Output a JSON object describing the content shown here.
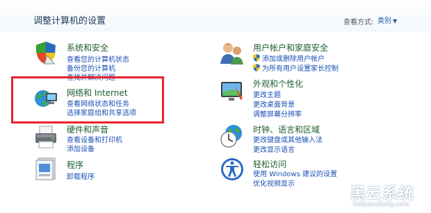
{
  "header": {
    "title": "调整计算机的设置",
    "view_label": "查看方式:",
    "view_value": "类别"
  },
  "categories": [
    {
      "title": "系统和安全",
      "icon": "security-shield-icon",
      "links": [
        "查看您的计算机状态",
        "备份您的计算机",
        "查找并解决问题"
      ]
    },
    {
      "title": "网络和 Internet",
      "icon": "network-globe-icon",
      "links": [
        "查看网络状态和任务",
        "选择家庭组和共享选项"
      ]
    },
    {
      "title": "硬件和声音",
      "icon": "printer-icon",
      "links": [
        "查看设备和打印机",
        "添加设备"
      ]
    },
    {
      "title": "程序",
      "icon": "programs-icon",
      "links": [
        "卸载程序"
      ]
    },
    {
      "title": "用户帐户和家庭安全",
      "icon": "users-icon",
      "links": [
        "添加或删除用户帐户",
        "为所有用户设置家长控制"
      ]
    },
    {
      "title": "外观和个性化",
      "icon": "appearance-monitor-icon",
      "links": [
        "更改主题",
        "更改桌面背景",
        "调整屏幕分辨率"
      ]
    },
    {
      "title": "时钟、语言和区域",
      "icon": "clock-globe-icon",
      "links": [
        "更改键盘或其他输入法",
        "更改显示语言"
      ]
    },
    {
      "title": "轻松访问",
      "icon": "ease-of-access-icon",
      "links": [
        "使用 Windows 建议的设置",
        "优化视频显示"
      ]
    }
  ],
  "watermark": {
    "name": "黑云系统",
    "url": "heiyunxitong.com"
  },
  "colors": {
    "highlight": "#e8232a",
    "title_green": "#1a5d2c",
    "link_blue": "#1a4fb4"
  }
}
